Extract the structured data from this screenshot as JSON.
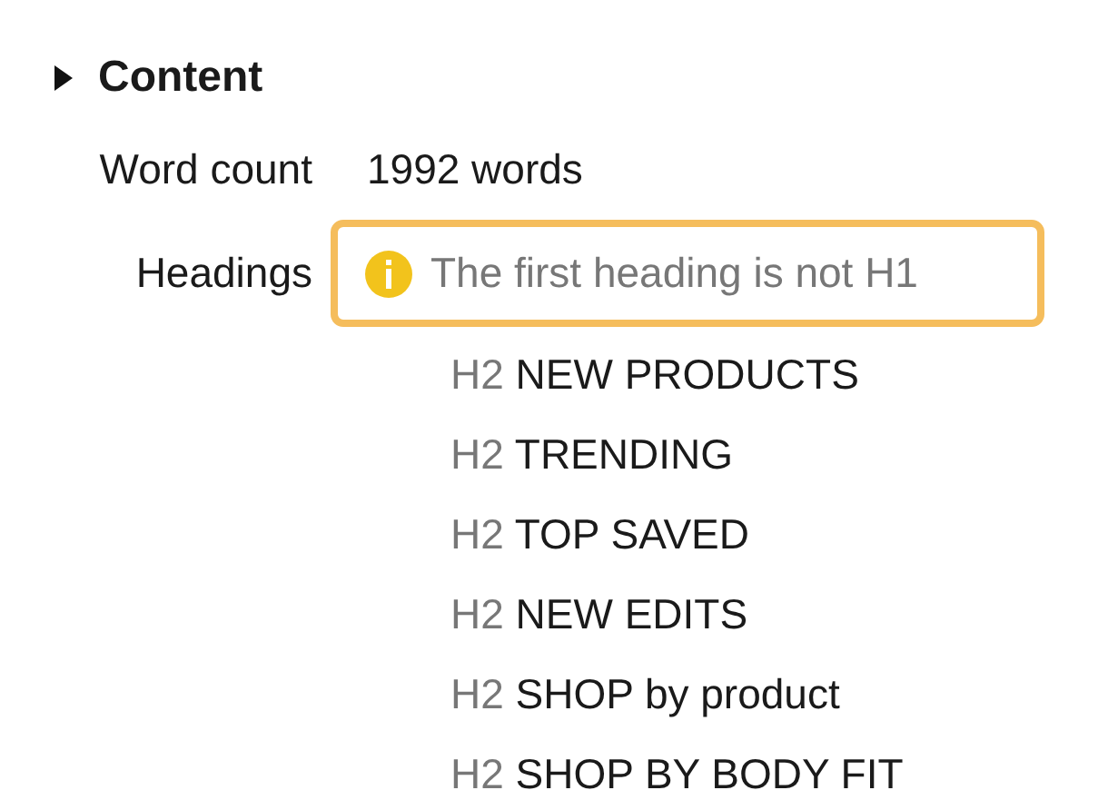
{
  "section": {
    "title": "Content"
  },
  "word_count": {
    "label": "Word count",
    "value": "1992 words"
  },
  "headings": {
    "label": "Headings",
    "warning": {
      "text": "The first heading is not H1"
    },
    "items": [
      {
        "level": "H2",
        "text": "NEW PRODUCTS"
      },
      {
        "level": "H2",
        "text": "TRENDING"
      },
      {
        "level": "H2",
        "text": "TOP SAVED"
      },
      {
        "level": "H2",
        "text": "NEW EDITS"
      },
      {
        "level": "H2",
        "text": "SHOP by product"
      },
      {
        "level": "H2",
        "text": "SHOP BY BODY FIT"
      }
    ]
  }
}
